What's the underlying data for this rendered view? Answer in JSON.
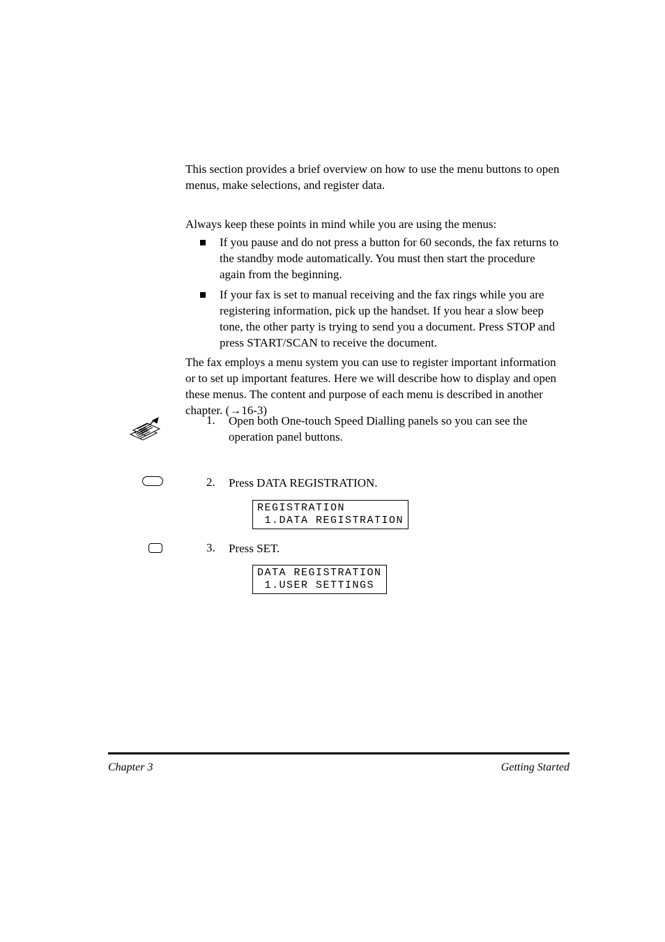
{
  "intro": "This section provides a brief overview on how to use the menu buttons to open menus, make selections, and register data.",
  "before_you_start": "Always keep these points in mind while you are using the menus:",
  "bullets": [
    "If you pause and do not press a button for 60 seconds, the fax returns to the standby mode automatically. You must then start the procedure again from the beginning.",
    "If your fax is set to manual receiving and the fax rings while you are registering information, pick up the handset. If you hear a slow beep tone, the other party is trying to send you a document. Press STOP and press START/SCAN to receive the document."
  ],
  "menu_system": "The fax employs a menu system you can use to register important information or to set up important features. Here we will describe how to display and open these menus. The content and purpose of each menu is described in another chapter. (→16-3)",
  "steps": {
    "s1": {
      "num": "1.",
      "text": "Open both One-touch Speed Dialling panels so you can see the operation panel buttons."
    },
    "s2": {
      "num": "2.",
      "text": "Press DATA REGISTRATION."
    },
    "s3": {
      "num": "3.",
      "text": "Press SET."
    }
  },
  "lcd1_line1": "REGISTRATION",
  "lcd1_line2": " 1.DATA REGISTRATION",
  "lcd2_line1": "DATA REGISTRATION",
  "lcd2_line2": " 1.USER SETTINGS",
  "footer": {
    "left": "Chapter 3",
    "right": "Getting Started"
  }
}
